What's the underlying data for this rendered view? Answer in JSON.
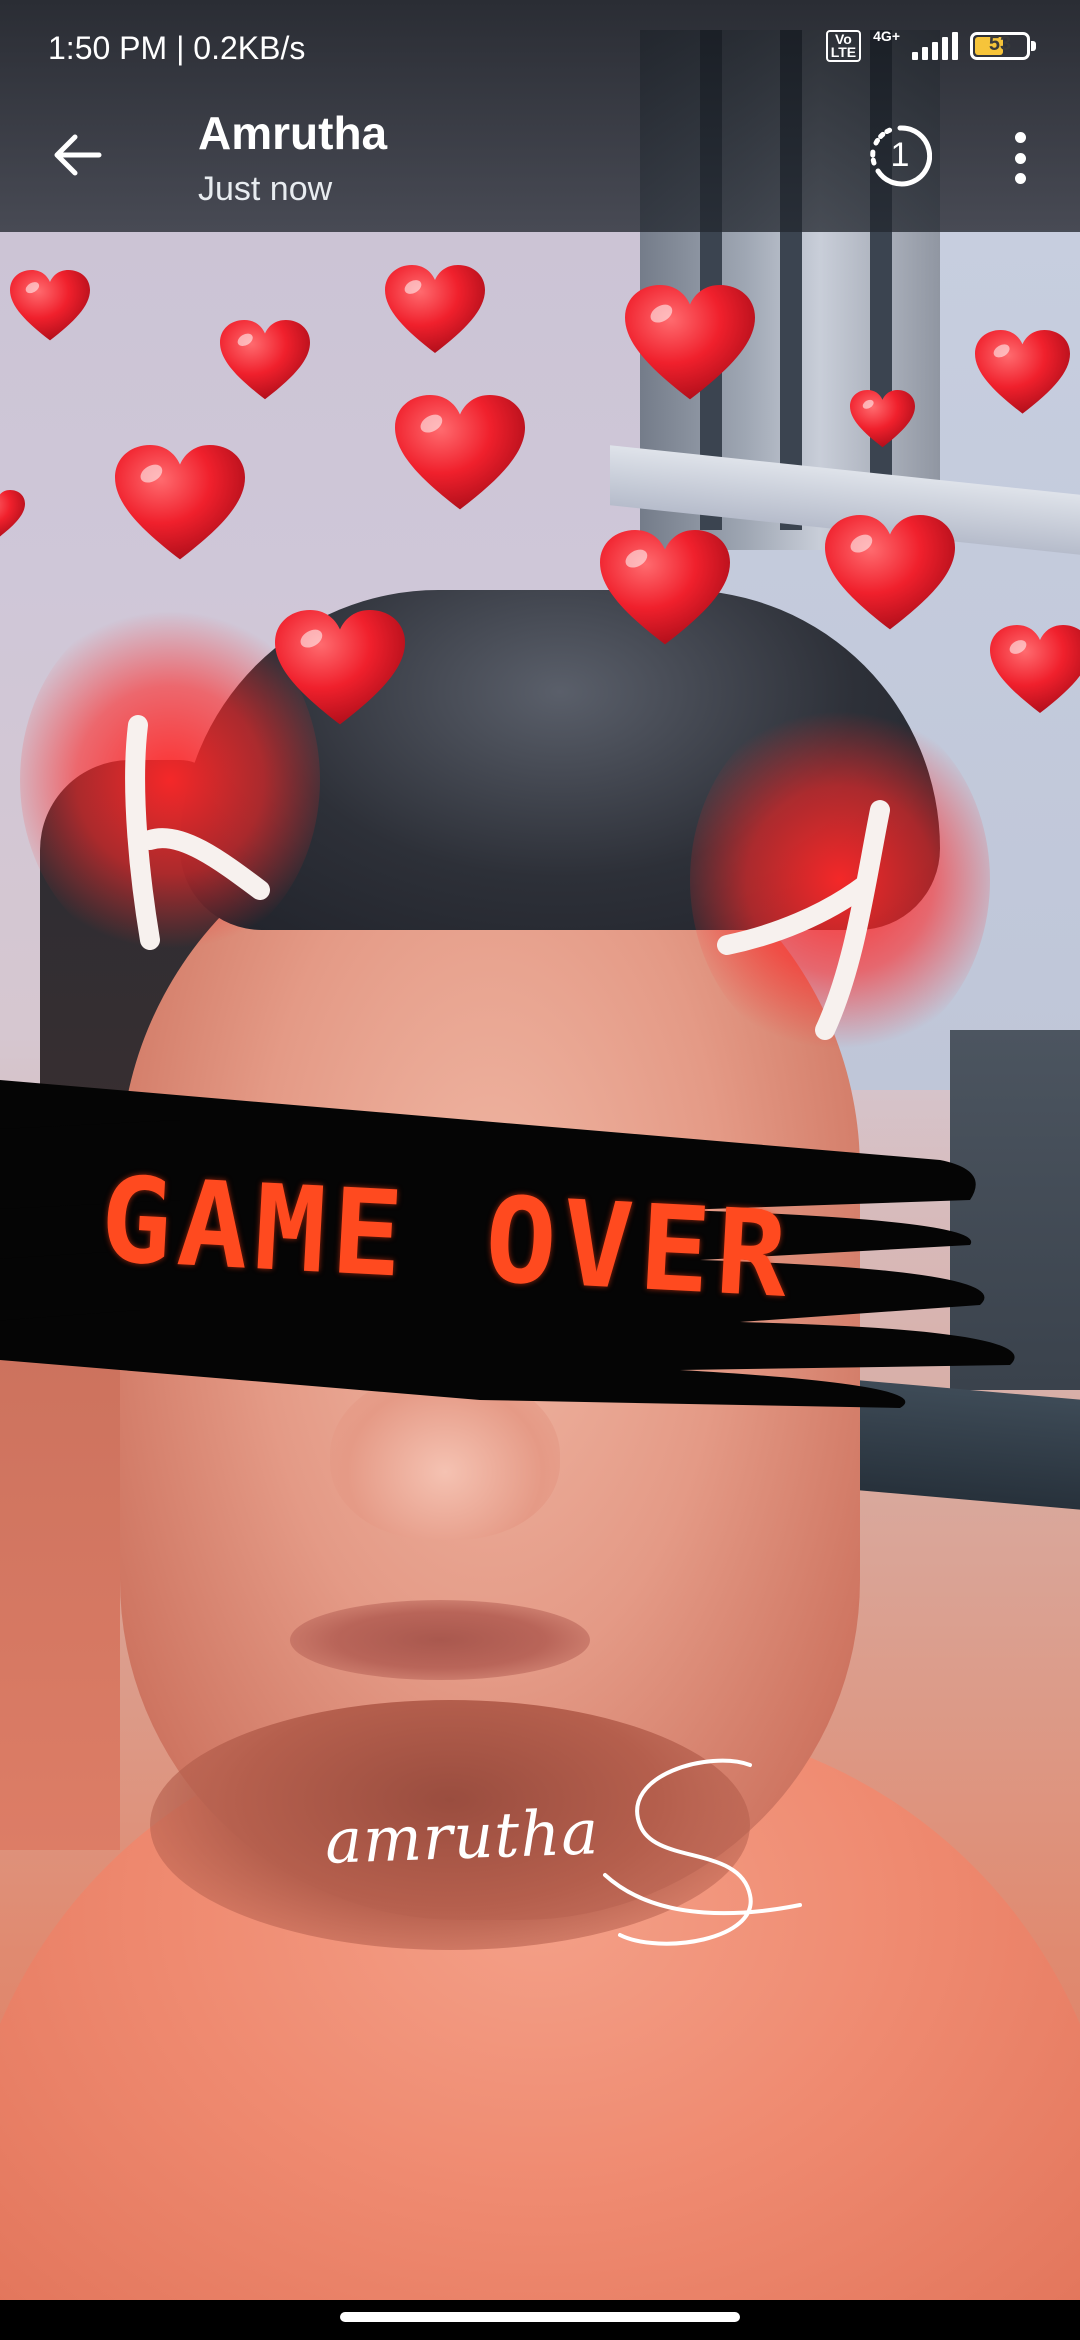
{
  "status_bar": {
    "time": "1:50 PM | 0.2KB/s",
    "volte_label": "Vo\nLTE",
    "network_type": "4G+",
    "battery_level": "53"
  },
  "header": {
    "contact_name": "Amrutha",
    "timestamp": "Just now",
    "views_count": "1",
    "back_icon": "arrow-left-icon",
    "views_icon": "eye-views-icon",
    "menu_icon": "more-vertical-icon"
  },
  "story": {
    "sticker_text": "GAME OVER",
    "signature_text": "amrutha",
    "sticker_color": "#ff4a1f",
    "heart_color": "#f0202c",
    "glow_color": "#ff2828"
  }
}
